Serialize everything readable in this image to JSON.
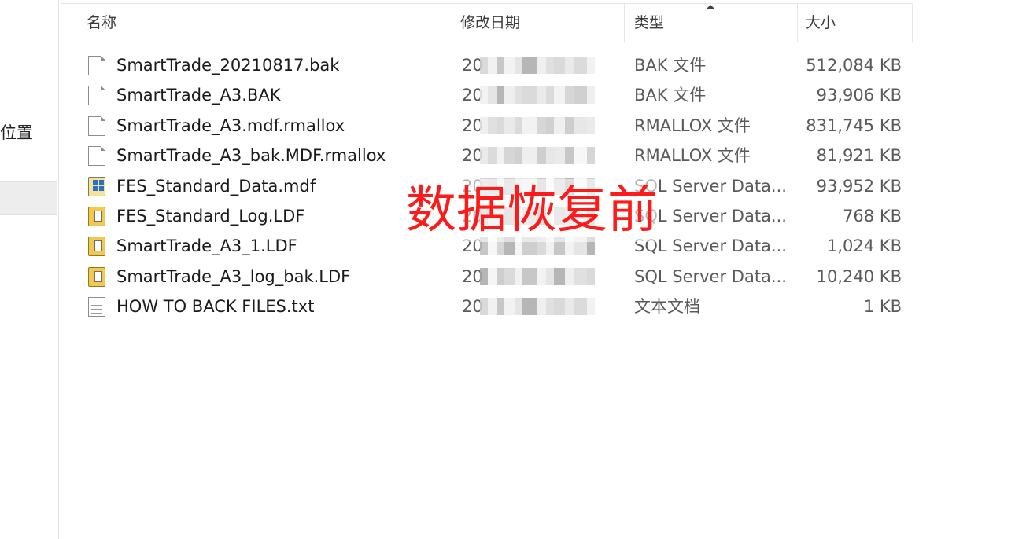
{
  "nav": {
    "partial_label": "位置"
  },
  "columns": {
    "name": "名称",
    "date": "修改日期",
    "type": "类型",
    "size": "大小"
  },
  "sort": {
    "column": "type",
    "direction": "ascending"
  },
  "files": [
    {
      "name": "SmartTrade_20210817.bak",
      "date": "20",
      "type": "BAK 文件",
      "size": "512,084 KB",
      "icon": "document-icon"
    },
    {
      "name": "SmartTrade_A3.BAK",
      "date": "20",
      "type": "BAK 文件",
      "size": "93,906 KB",
      "icon": "document-icon"
    },
    {
      "name": "SmartTrade_A3.mdf.rmallox",
      "date": "20",
      "type": "RMALLOX 文件",
      "size": "831,745 KB",
      "icon": "document-icon"
    },
    {
      "name": "SmartTrade_A3_bak.MDF.rmallox",
      "date": "20",
      "type": "RMALLOX 文件",
      "size": "81,921 KB",
      "icon": "document-icon"
    },
    {
      "name": "FES_Standard_Data.mdf",
      "date": "20",
      "type": "SQL Server Data...",
      "size": "93,952 KB",
      "icon": "sql-data-icon"
    },
    {
      "name": "FES_Standard_Log.LDF",
      "date": "20",
      "type": "SQL Server Data...",
      "size": "768 KB",
      "icon": "sql-log-icon"
    },
    {
      "name": "SmartTrade_A3_1.LDF",
      "date": "20",
      "type": "SQL Server Data...",
      "size": "1,024 KB",
      "icon": "sql-log-icon"
    },
    {
      "name": "SmartTrade_A3_log_bak.LDF",
      "date": "20",
      "type": "SQL Server Data...",
      "size": "10,240 KB",
      "icon": "sql-log-icon"
    },
    {
      "name": "HOW TO BACK FILES.txt",
      "date": "20",
      "type": "文本文档",
      "size": "1 KB",
      "icon": "text-document-icon"
    }
  ],
  "overlay_text": "数据恢复前",
  "colors": {
    "overlay": "#ff1a1a",
    "header_text": "#3b3b3b",
    "meta_text": "#5a5a5a"
  }
}
